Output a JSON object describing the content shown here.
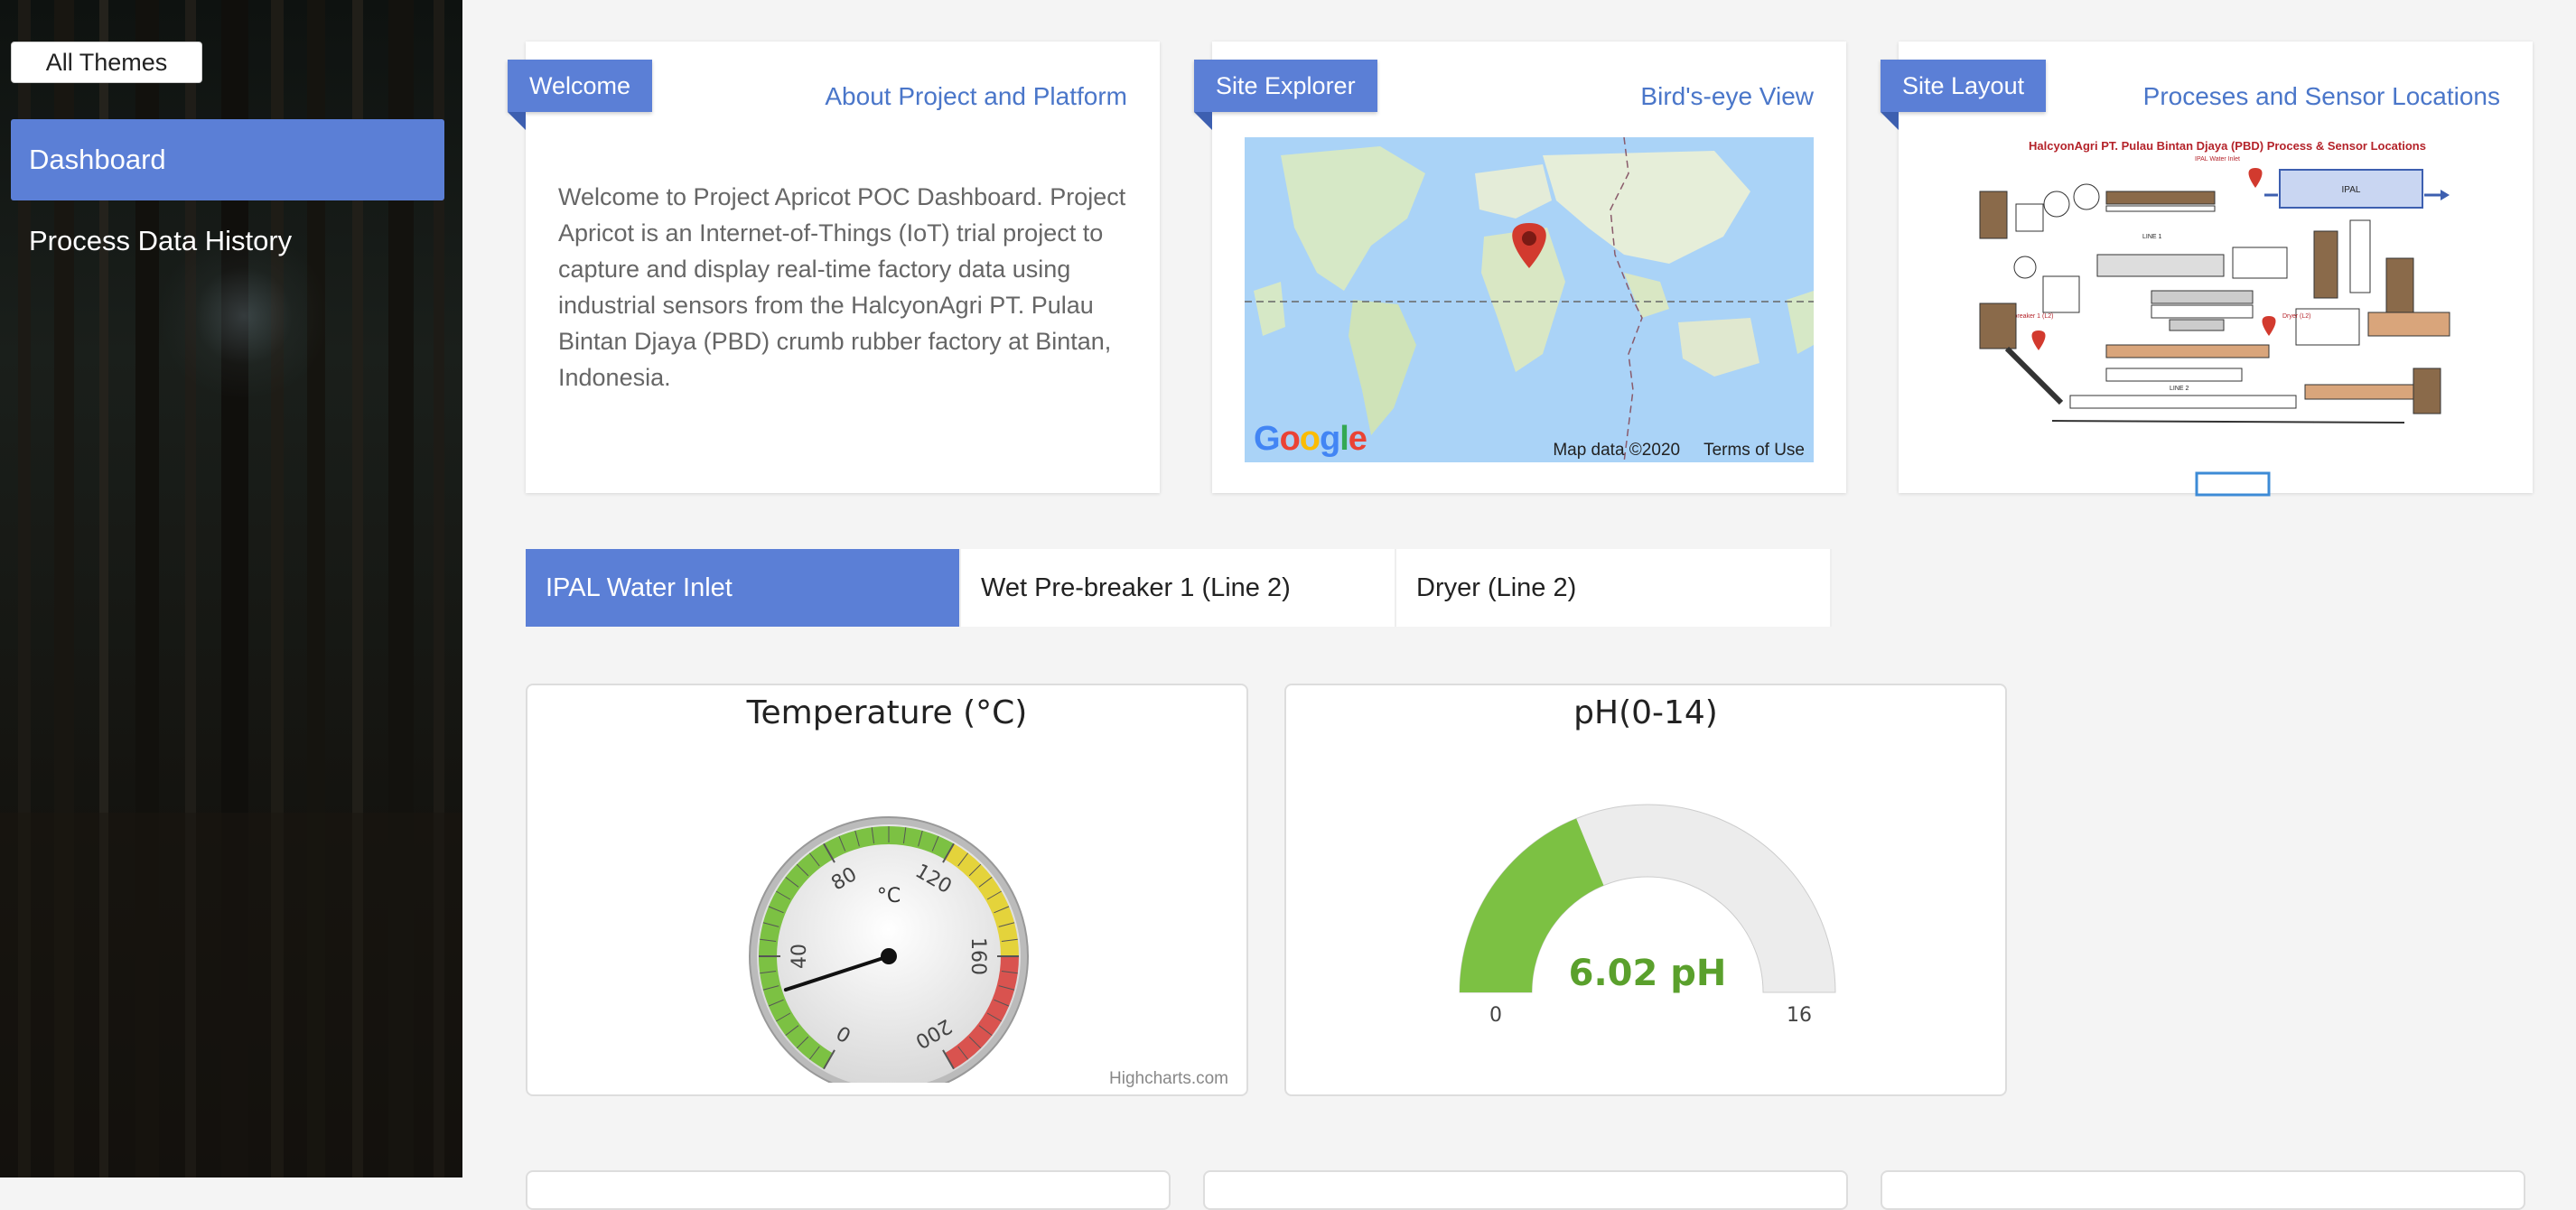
{
  "sidebar": {
    "themes_button": "All Themes",
    "items": [
      {
        "label": "Dashboard",
        "active": true
      },
      {
        "label": "Process Data History",
        "active": false
      }
    ]
  },
  "cards": {
    "welcome": {
      "badge": "Welcome",
      "link": "About Project and Platform",
      "text": "Welcome to Project Apricot POC Dashboard. Project Apricot is an Internet-of-Things (IoT) trial project to capture and display real-time factory data using industrial sensors from the HalcyonAgri PT. Pulau Bintan Djaya (PBD) crumb rubber factory at Bintan, Indonesia."
    },
    "site_explorer": {
      "badge": "Site Explorer",
      "link": "Bird's-eye View",
      "map_logo": "Google",
      "map_data": "Map data ©2020",
      "terms": "Terms of Use"
    },
    "site_layout": {
      "badge": "Site Layout",
      "link": "Proceses and Sensor Locations",
      "diagram_title": "HalcyonAgri PT. Pulau Bintan Djaya (PBD) Process & Sensor Locations",
      "labels": {
        "ipal_water_inlet": "IPAL Water Inlet",
        "ipal": "IPAL",
        "line1": "LINE 1",
        "line2": "LINE 2",
        "wet_prebreaker": "Wet Pre-breaker 1 (L2)",
        "dryer": "Dryer (L2)"
      }
    }
  },
  "tabs": [
    {
      "label": "IPAL Water Inlet",
      "active": true
    },
    {
      "label": "Wet Pre-breaker 1 (Line 2)",
      "active": false
    },
    {
      "label": "Dryer (Line 2)",
      "active": false
    }
  ],
  "gauges": {
    "temperature": {
      "title": "Temperature (°C)",
      "unit": "°C",
      "min": 0,
      "max": 200,
      "value": 28,
      "ticks": [
        "0",
        "40",
        "80",
        "120",
        "160",
        "200"
      ],
      "credit": "Highcharts.com"
    },
    "ph": {
      "title": "pH(0-14)",
      "min_label": "0",
      "max_label": "16",
      "min": 0,
      "max": 16,
      "value": 6.02,
      "value_label": "6.02 pH"
    }
  },
  "colors": {
    "accent": "#5b7fd6",
    "green": "#7cc143",
    "yellow": "#e4d33b",
    "red": "#d9534f"
  }
}
